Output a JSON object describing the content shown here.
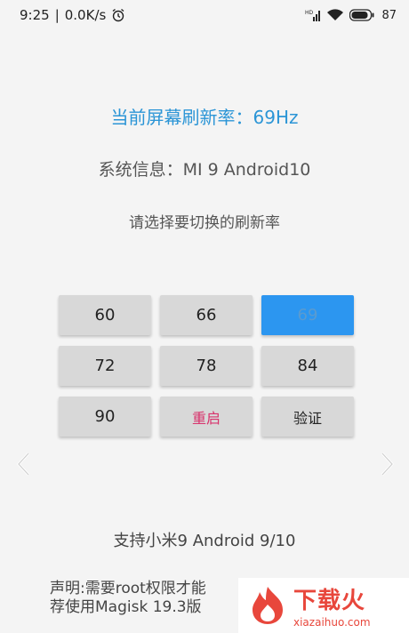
{
  "status_bar": {
    "time": "9:25",
    "network_speed": "0.0K/s",
    "battery_percent": "87",
    "icons": [
      "alarm-icon",
      "signal-icon",
      "wifi-icon",
      "battery-icon"
    ]
  },
  "main": {
    "current_rate_label": "当前屏幕刷新率：69Hz",
    "system_info": "系统信息：MI 9    Android10",
    "prompt": "请选择要切换的刷新率"
  },
  "rate_buttons": [
    {
      "label": "60",
      "selected": false
    },
    {
      "label": "66",
      "selected": false
    },
    {
      "label": "69",
      "selected": true
    },
    {
      "label": "72",
      "selected": false
    },
    {
      "label": "78",
      "selected": false
    },
    {
      "label": "84",
      "selected": false
    },
    {
      "label": "90",
      "selected": false
    }
  ],
  "actions": {
    "restart_label": "重启",
    "verify_label": "验证"
  },
  "footer": {
    "support": "支持小米9 Android 9/10",
    "disclaimer_line1": "声明:需要root权限才能",
    "disclaimer_line2": "荐使用Magisk 19.3版"
  },
  "watermark": {
    "brand": "下载火",
    "domain": "xiazaihuo.com"
  },
  "colors": {
    "accent_blue": "#2b95d6",
    "selected_button": "#2c96f0",
    "restart_text": "#d8336c",
    "button_bg": "#d8d8d8",
    "watermark_red": "#e8473c"
  }
}
